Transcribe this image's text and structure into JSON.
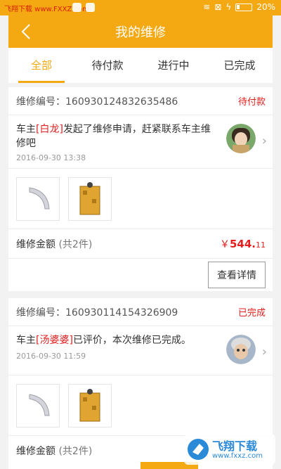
{
  "statusbar": {
    "watermark": "飞翔下载 www.FXXZ.com",
    "battery": "20%"
  },
  "header": {
    "title": "我的维修"
  },
  "tabs": [
    {
      "label": "全部",
      "active": true
    },
    {
      "label": "待付款",
      "active": false
    },
    {
      "label": "进行中",
      "active": false
    },
    {
      "label": "已完成",
      "active": false
    }
  ],
  "orders": [
    {
      "order_label": "维修编号：",
      "order_no": "160930124832635486",
      "status": "待付款",
      "msg_prefix": "车主",
      "owner": "[白龙]",
      "msg_suffix": "发起了维修申请，赶紧联系车主维修吧",
      "date": "2016-09-30 13:38",
      "amount_label": "维修金额",
      "count_text": "(共2件)",
      "price_symbol": "￥",
      "price_int": "544.",
      "price_dec": "11",
      "button": "查看详情"
    },
    {
      "order_label": "维修编号：",
      "order_no": "160930114154326909",
      "status": "已完成",
      "msg_prefix": "车主",
      "owner": "[汤婆婆]",
      "msg_suffix": "已评价，本次维修已完成。",
      "date": "2016-09-30 11:59",
      "amount_label": "维修金额",
      "count_text": "(共2件)"
    }
  ],
  "watermark_bottom": {
    "brand": "飞翔下载",
    "url": "www.fxxz.com"
  },
  "colors": {
    "accent": "#f4a912",
    "status_red": "#e02020"
  }
}
